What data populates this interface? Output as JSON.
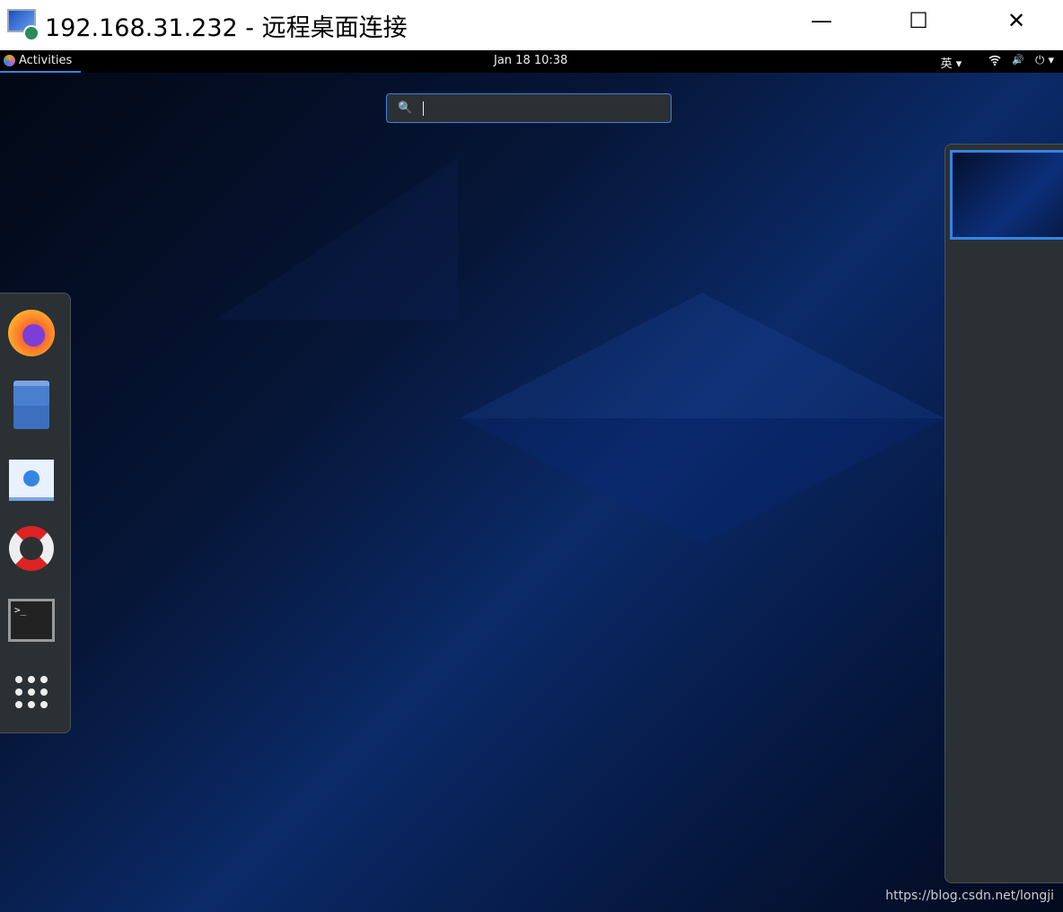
{
  "window": {
    "title": "192.168.31.232 - 远程桌面连接",
    "minimize": "—",
    "maximize": "☐",
    "close": "✕"
  },
  "topbar": {
    "activities": "Activities",
    "clock": "Jan 18  10:38",
    "input_method": "英 ▾",
    "tray": {
      "wifi": "wifi-icon",
      "volume": "🔊",
      "power": "⏻ ▾"
    }
  },
  "search": {
    "icon": "🔍",
    "value": ""
  },
  "dock": {
    "apps": [
      "Firefox",
      "Files",
      "Software",
      "Help",
      "Terminal",
      "Show Applications"
    ]
  },
  "watermark": "https://blog.csdn.net/longji",
  "colors": {
    "accent": "#3584e4",
    "panel": "#2b3034"
  }
}
